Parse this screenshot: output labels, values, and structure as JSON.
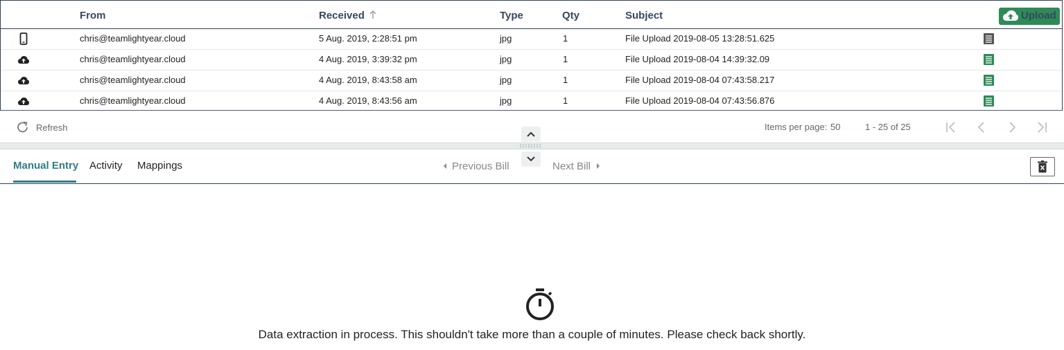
{
  "table": {
    "columns": {
      "from": "From",
      "received": "Received",
      "type": "Type",
      "qty": "Qty",
      "subject": "Subject"
    },
    "upload_label": "Upload",
    "rows": [
      {
        "source_icon": "mobile-phone-icon",
        "from": "chris@teamlightyear.cloud",
        "received": "5 Aug. 2019, 2:28:51 pm",
        "type": "jpg",
        "qty": "1",
        "subject": "File Upload 2019-08-05 13:28:51.625",
        "doc_color": "#555555"
      },
      {
        "source_icon": "cloud-upload-icon",
        "from": "chris@teamlightyear.cloud",
        "received": "4 Aug. 2019, 3:39:32 pm",
        "type": "jpg",
        "qty": "1",
        "subject": "File Upload 2019-08-04 14:39:32.09",
        "doc_color": "#2e8b57"
      },
      {
        "source_icon": "cloud-upload-icon",
        "from": "chris@teamlightyear.cloud",
        "received": "4 Aug. 2019, 8:43:58 am",
        "type": "jpg",
        "qty": "1",
        "subject": "File Upload 2019-08-04 07:43:58.217",
        "doc_color": "#2e8b57"
      },
      {
        "source_icon": "cloud-upload-icon",
        "from": "chris@teamlightyear.cloud",
        "received": "4 Aug. 2019, 8:43:56 am",
        "type": "jpg",
        "qty": "1",
        "subject": "File Upload 2019-08-04 07:43:56.876",
        "doc_color": "#2e8b57"
      }
    ]
  },
  "toolbar": {
    "refresh_label": "Refresh",
    "items_per_page_label": "Items per page:",
    "items_per_page_value": "50",
    "range_label": "1 - 25 of 25"
  },
  "tabs": {
    "manual_entry": "Manual Entry",
    "activity": "Activity",
    "mappings": "Mappings"
  },
  "bill_nav": {
    "previous": "Previous Bill",
    "next": "Next Bill"
  },
  "status": {
    "message": "Data extraction in process. This shouldn't take more than a couple of minutes. Please check back shortly."
  },
  "colors": {
    "accent": "#2f7d88",
    "upload_green": "#2e8b57",
    "header_text": "#37475f"
  }
}
